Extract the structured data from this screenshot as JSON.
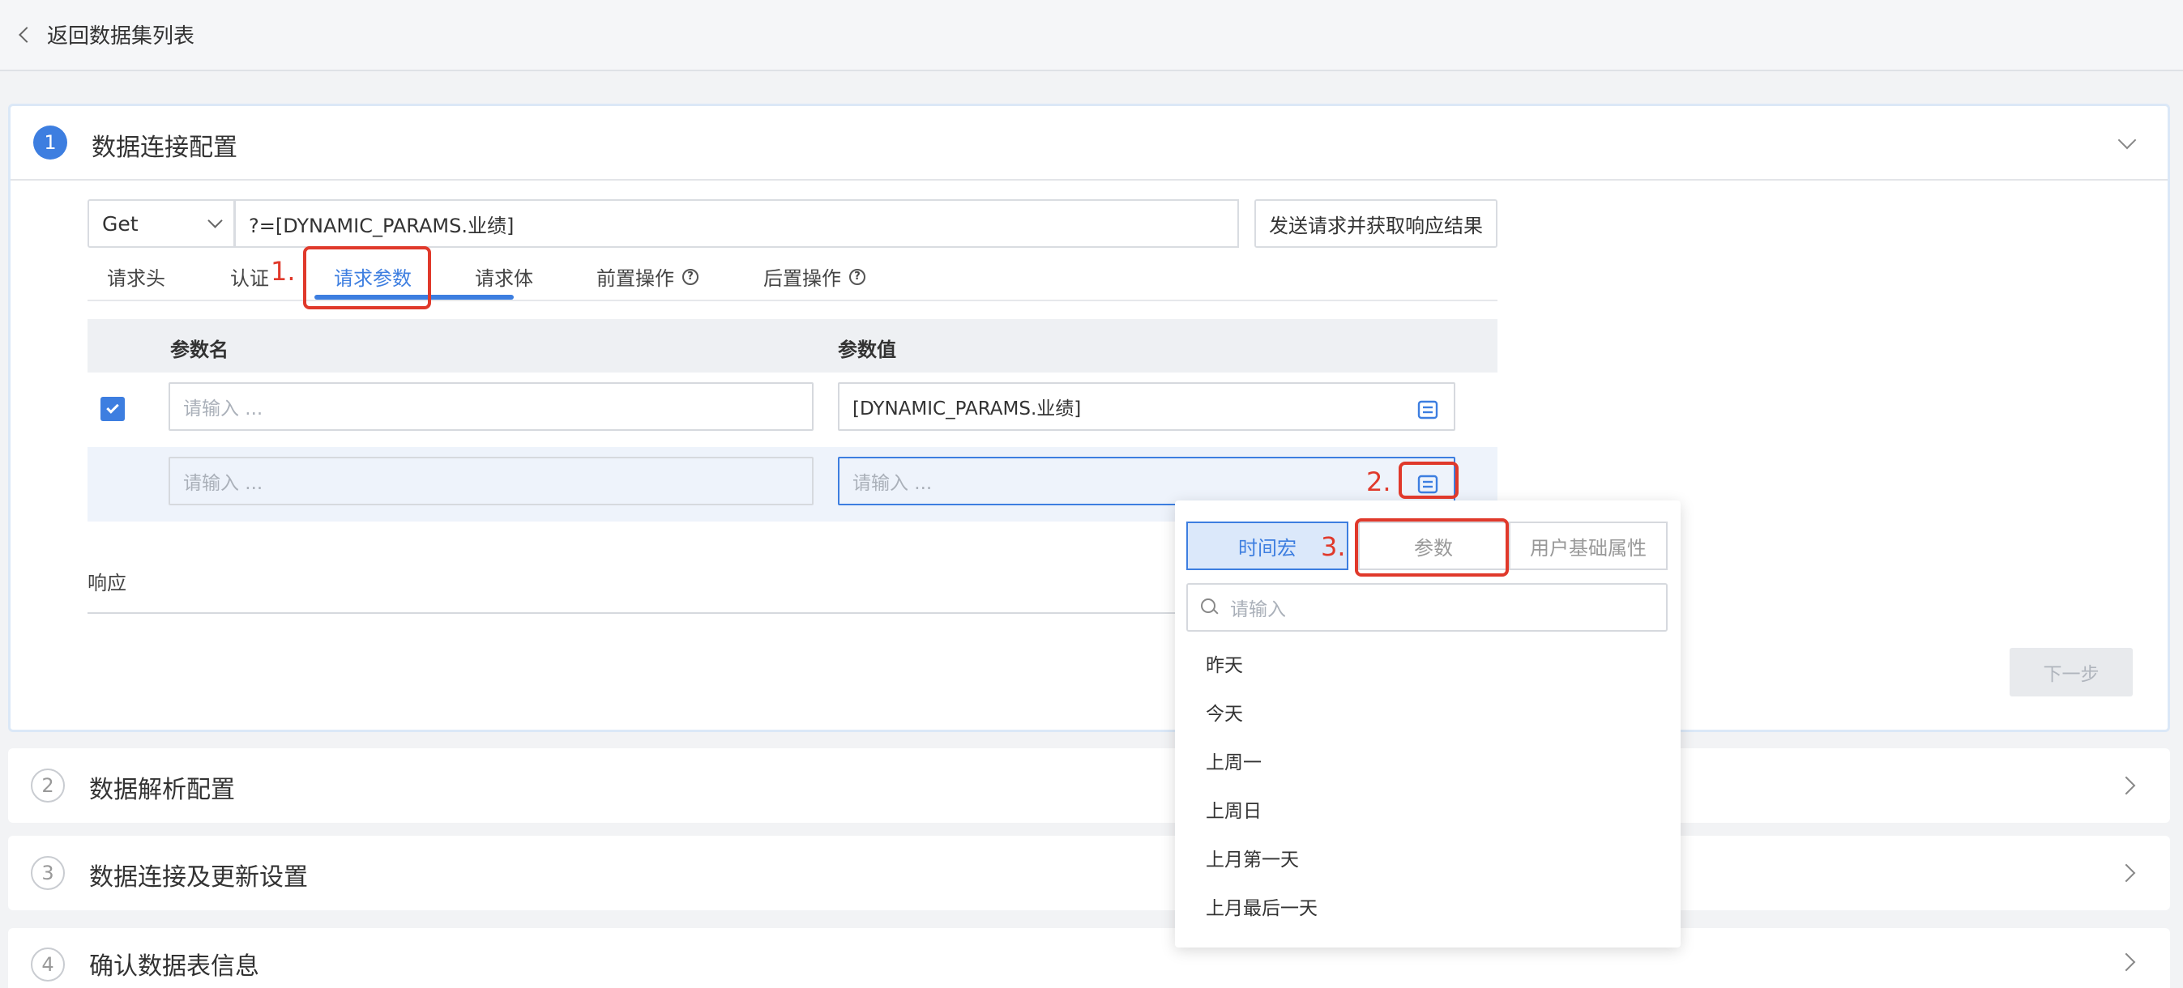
{
  "header": {
    "back_label": "返回数据集列表"
  },
  "sections": [
    {
      "num": "1",
      "title": "数据连接配置"
    },
    {
      "num": "2",
      "title": "数据解析配置"
    },
    {
      "num": "3",
      "title": "数据连接及更新设置"
    },
    {
      "num": "4",
      "title": "确认数据表信息"
    }
  ],
  "request": {
    "method": "Get",
    "url": "?=[DYNAMIC_PARAMS.业绩]",
    "send_label": "发送请求并获取响应结果"
  },
  "tabs": [
    "请求头",
    "认证",
    "请求参数",
    "请求体",
    "前置操作",
    "后置操作"
  ],
  "params": {
    "col_name": "参数名",
    "col_value": "参数值",
    "rows": [
      {
        "name": "",
        "name_placeholder": "请输入 ...",
        "value": "[DYNAMIC_PARAMS.业绩]",
        "checked": true
      },
      {
        "name": "",
        "name_placeholder": "请输入 ...",
        "value_placeholder": "请输入 ..."
      }
    ]
  },
  "response_label": "响应",
  "next_label": "下一步",
  "popup": {
    "tabs": [
      "时间宏",
      "参数",
      "用户基础属性"
    ],
    "selected_tab": "时间宏",
    "search_placeholder": "请输入",
    "options": [
      "昨天",
      "今天",
      "上周一",
      "上周日",
      "上月第一天",
      "上月最后一天"
    ]
  },
  "annotations": [
    "1.",
    "2.",
    "3."
  ],
  "colors": {
    "accent": "#3d7ee0",
    "annotation_red": "#e0392b"
  },
  "icons": {
    "back": "chevron-left-icon",
    "collapse": "chevron-down-icon",
    "expand": "chevron-right-icon",
    "help": "question-circle-icon",
    "variable": "variable-insert-icon",
    "search": "search-icon"
  }
}
